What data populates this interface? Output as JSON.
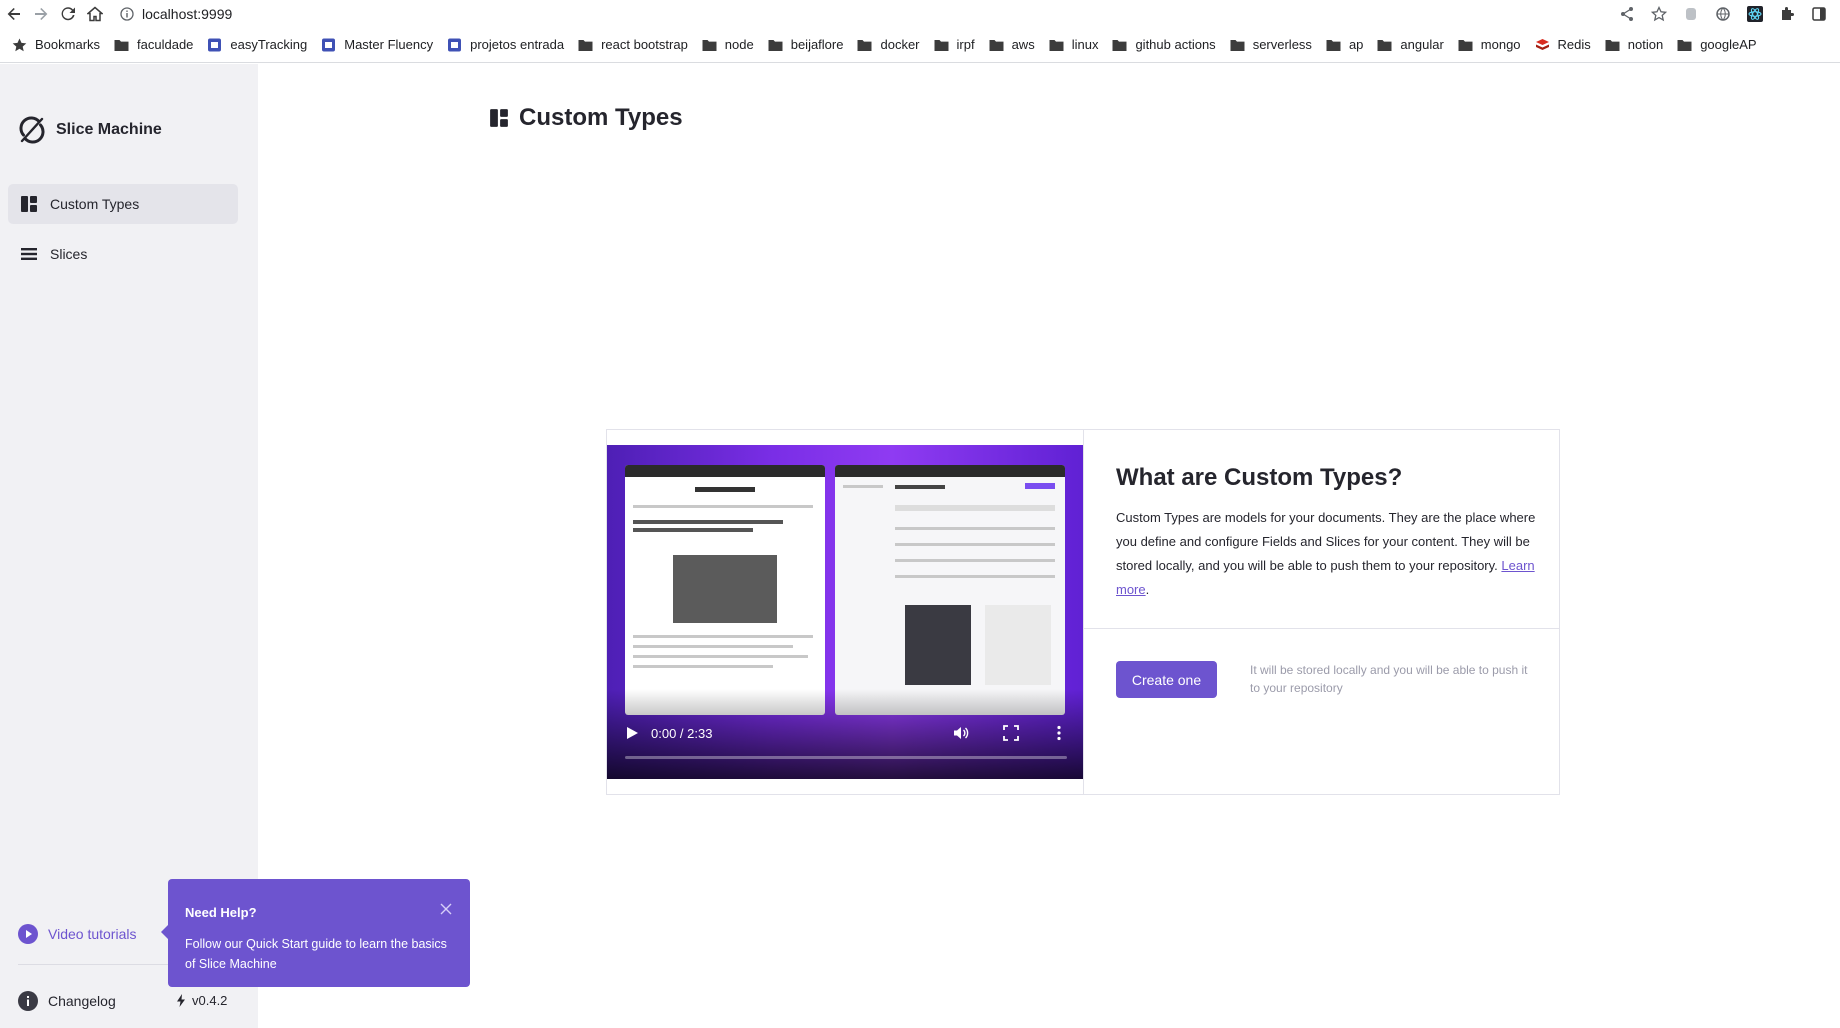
{
  "browser": {
    "url": "localhost:9999",
    "bookmarks": [
      {
        "label": "Bookmarks",
        "icon": "star-icon"
      },
      {
        "label": "faculdade",
        "icon": "folder-icon"
      },
      {
        "label": "easyTracking",
        "icon": "site-icon"
      },
      {
        "label": "Master Fluency",
        "icon": "site-icon"
      },
      {
        "label": "projetos entrada",
        "icon": "site-icon"
      },
      {
        "label": "react bootstrap",
        "icon": "folder-icon"
      },
      {
        "label": "node",
        "icon": "folder-icon"
      },
      {
        "label": "beijaflore",
        "icon": "folder-icon"
      },
      {
        "label": "docker",
        "icon": "folder-icon"
      },
      {
        "label": "irpf",
        "icon": "folder-icon"
      },
      {
        "label": "aws",
        "icon": "folder-icon"
      },
      {
        "label": "linux",
        "icon": "folder-icon"
      },
      {
        "label": "github actions",
        "icon": "folder-icon"
      },
      {
        "label": "serverless",
        "icon": "folder-icon"
      },
      {
        "label": "ap",
        "icon": "folder-icon"
      },
      {
        "label": "angular",
        "icon": "folder-icon"
      },
      {
        "label": "mongo",
        "icon": "folder-icon"
      },
      {
        "label": "Redis",
        "icon": "redis-icon"
      },
      {
        "label": "notion",
        "icon": "folder-icon"
      },
      {
        "label": "googleAP",
        "icon": "folder-icon"
      }
    ]
  },
  "sidebar": {
    "brand": "Slice Machine",
    "items": [
      {
        "label": "Custom Types",
        "icon": "custom-types-icon",
        "active": true
      },
      {
        "label": "Slices",
        "icon": "slices-icon",
        "active": false
      }
    ],
    "video_tutorials": "Video tutorials",
    "changelog": "Changelog",
    "version": "v0.4.2"
  },
  "tooltip": {
    "title": "Need Help?",
    "body": "Follow our Quick Start guide to learn the basics of Slice Machine"
  },
  "page": {
    "title": "Custom Types"
  },
  "card": {
    "video_time": "0:00 / 2:33",
    "heading": "What are Custom Types?",
    "description": "Custom Types are models for your documents. They are the place where you define and configure Fields and Slices for your content. They will be stored locally, and you will be able to push them to your repository.",
    "learn_more": "Learn more",
    "create_button": "Create one",
    "note": "It will be stored locally and you will be able to push it to your repository"
  },
  "colors": {
    "accent": "#6d54cf",
    "sidebar_bg": "#f1f1f4"
  }
}
